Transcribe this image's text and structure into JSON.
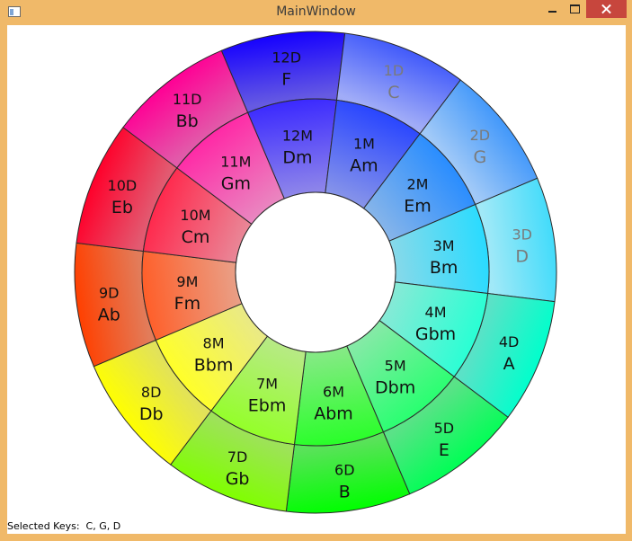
{
  "window": {
    "title": "MainWindow"
  },
  "wheel": {
    "outer": [
      {
        "code": "12D",
        "key": "F",
        "selected": false
      },
      {
        "code": "1D",
        "key": "C",
        "selected": true
      },
      {
        "code": "2D",
        "key": "G",
        "selected": true
      },
      {
        "code": "3D",
        "key": "D",
        "selected": true
      },
      {
        "code": "4D",
        "key": "A",
        "selected": false
      },
      {
        "code": "5D",
        "key": "E",
        "selected": false
      },
      {
        "code": "6D",
        "key": "B",
        "selected": false
      },
      {
        "code": "7D",
        "key": "Gb",
        "selected": false
      },
      {
        "code": "8D",
        "key": "Db",
        "selected": false
      },
      {
        "code": "9D",
        "key": "Ab",
        "selected": false
      },
      {
        "code": "10D",
        "key": "Eb",
        "selected": false
      },
      {
        "code": "11D",
        "key": "Bb",
        "selected": false
      }
    ],
    "inner": [
      {
        "code": "12M",
        "key": "Dm"
      },
      {
        "code": "1M",
        "key": "Am"
      },
      {
        "code": "2M",
        "key": "Em"
      },
      {
        "code": "3M",
        "key": "Bm"
      },
      {
        "code": "4M",
        "key": "Gbm"
      },
      {
        "code": "5M",
        "key": "Dbm"
      },
      {
        "code": "6M",
        "key": "Abm"
      },
      {
        "code": "7M",
        "key": "Ebm"
      },
      {
        "code": "8M",
        "key": "Bbm"
      },
      {
        "code": "9M",
        "key": "Fm"
      },
      {
        "code": "10M",
        "key": "Cm"
      },
      {
        "code": "11M",
        "key": "Gm"
      }
    ],
    "selected_text_color": "#7a7a7a"
  },
  "status": {
    "text": "Selected Keys:  C, G, D"
  }
}
